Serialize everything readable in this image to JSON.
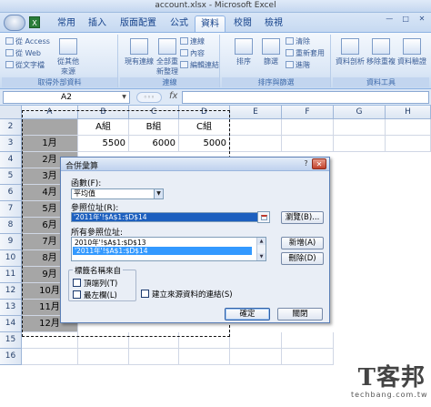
{
  "window": {
    "title": "account.xlsx - Microsoft Excel",
    "controls": [
      "—",
      "□",
      "✕"
    ]
  },
  "tabs": [
    {
      "label": "常用",
      "active": false
    },
    {
      "label": "插入",
      "active": false
    },
    {
      "label": "版面配置",
      "active": false
    },
    {
      "label": "公式",
      "active": false
    },
    {
      "label": "資料",
      "active": true
    },
    {
      "label": "校閱",
      "active": false
    },
    {
      "label": "檢視",
      "active": false
    }
  ],
  "ribbon": {
    "get_external": {
      "label": "取得外部資料",
      "items": [
        "從 Access",
        "從 Web",
        "從文字檔",
        "從其他來源"
      ]
    },
    "connections": {
      "label": "連線",
      "items": [
        "現有連線",
        "全部重新整理",
        "連線",
        "內容",
        "編輯連結"
      ]
    },
    "sort_filter": {
      "label": "排序與篩選",
      "items": [
        "排序",
        "篩選",
        "清除",
        "重新套用",
        "進階"
      ]
    },
    "data_tools": {
      "label": "資料工具",
      "items": [
        "資料剖析",
        "移除重複",
        "資料驗證"
      ]
    }
  },
  "formula_bar": {
    "name_box": "A2",
    "fx": "fx",
    "formula": ""
  },
  "sheet": {
    "columns": [
      "A",
      "B",
      "C",
      "D",
      "E",
      "F",
      "G",
      "H"
    ],
    "rows": [
      "2",
      "3",
      "4",
      "5",
      "6",
      "7",
      "8",
      "9",
      "10",
      "11",
      "12",
      "13",
      "14",
      "15",
      "16"
    ],
    "header_row": [
      "",
      "A組",
      "B組",
      "C組"
    ],
    "row3": [
      "1月",
      "5500",
      "6000",
      "5000"
    ],
    "months": [
      "2月",
      "3月",
      "4月",
      "5月",
      "6月",
      "7月",
      "8月",
      "9月",
      "10月",
      "11月",
      "12月"
    ]
  },
  "dialog": {
    "title": "合併彙算",
    "function_label": "函數(F):",
    "function_value": "平均值",
    "reference_label": "參照位址(R):",
    "reference_value": "'2011年'!$A$1:$D$14",
    "browse_button": "瀏覽(B)...",
    "all_refs_label": "所有參照位址:",
    "all_refs": [
      "2010年'!$A$1:$D$13",
      "'2011年'!$A$1:$D$14"
    ],
    "add_button": "新增(A)",
    "delete_button": "刪除(D)",
    "label_group_title": "標籤名稱來自",
    "top_row": "頂端列(T)",
    "left_column": "最左欄(L)",
    "link_source": "建立來源資料的連結(S)",
    "ok_button": "確定",
    "close_button": "關閉",
    "help": "?",
    "close_icon": "✕"
  },
  "watermark": {
    "mark": "T客邦",
    "sub": "techbang.com.tw"
  }
}
